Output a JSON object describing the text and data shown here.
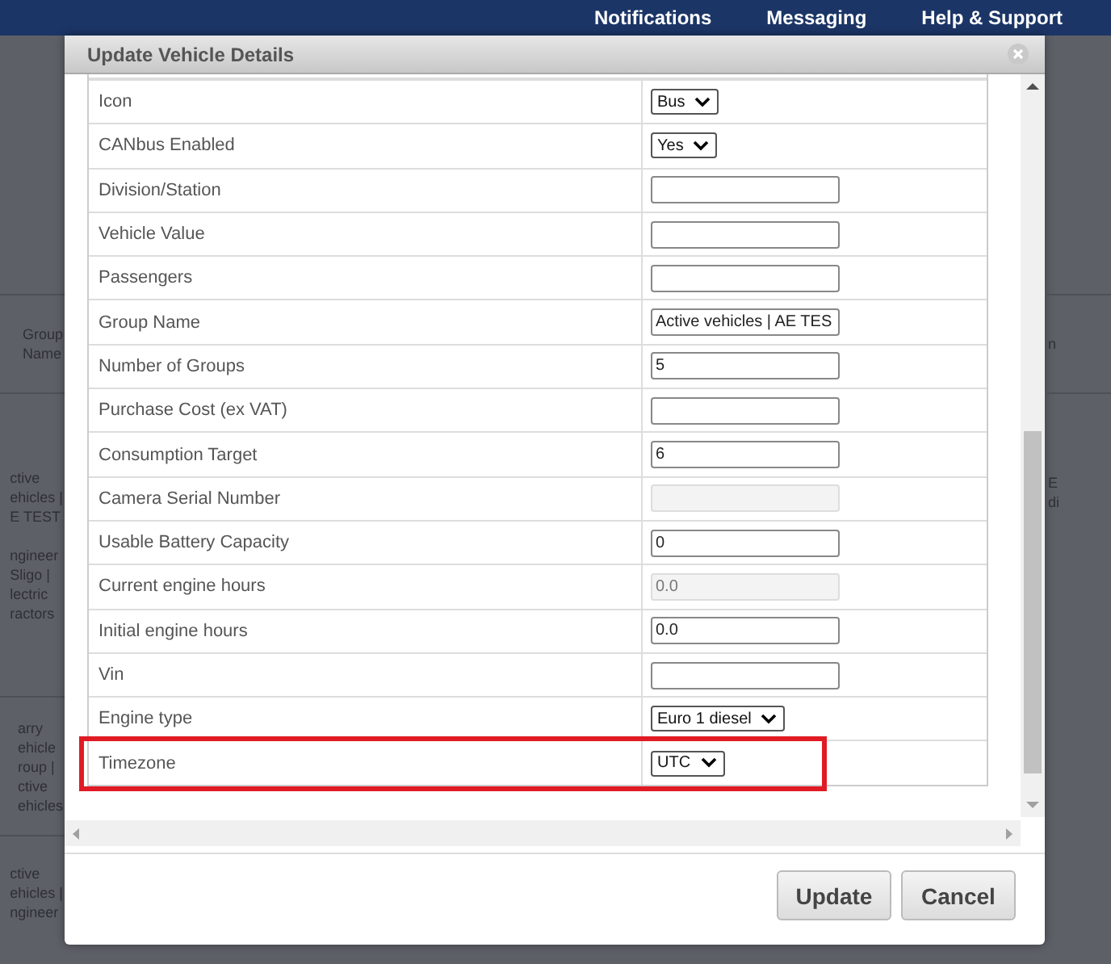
{
  "top_nav": [
    {
      "label": "Notifications"
    },
    {
      "label": "Messaging"
    },
    {
      "label": "Help & Support"
    }
  ],
  "background_table": {
    "left_column": [
      "Group\nName",
      "ctive\nehicles |\nE TEST\n\nngineer\nSligo |\nlectric\nractors",
      "arry\nehicle\nroup |\nctive\nehicles",
      "ctive\nehicles |\nngineer"
    ],
    "right_column": [
      "n",
      "E\ndi"
    ]
  },
  "dialog": {
    "title": "Update Vehicle Details",
    "rows": [
      {
        "label": "Icon",
        "kind": "select",
        "value": "Bus",
        "highlighted": false
      },
      {
        "label": "CANbus Enabled",
        "kind": "select",
        "value": "Yes",
        "highlighted": false
      },
      {
        "label": "Division/Station",
        "kind": "input",
        "highlighted": false
      },
      {
        "label": "Vehicle Value",
        "kind": "input",
        "highlighted": false
      },
      {
        "label": "Passengers",
        "kind": "input",
        "highlighted": false
      },
      {
        "label": "Group Name",
        "kind": "input",
        "value": "Active vehicles | AE TES",
        "highlighted": false
      },
      {
        "label": "Number of Groups",
        "kind": "input",
        "value": "5",
        "highlighted": false
      },
      {
        "label": "Purchase Cost (ex VAT)",
        "kind": "input",
        "highlighted": false
      },
      {
        "label": "Consumption Target",
        "kind": "input",
        "value": "6",
        "highlighted": false
      },
      {
        "label": "Camera Serial Number",
        "kind": "readonly",
        "highlighted": false
      },
      {
        "label": "Usable Battery Capacity",
        "kind": "input",
        "value": "0",
        "highlighted": false
      },
      {
        "label": "Current engine hours",
        "kind": "readonly",
        "value": "0.0",
        "highlighted": false
      },
      {
        "label": "Initial engine hours",
        "kind": "input",
        "value": "0.0",
        "highlighted": false
      },
      {
        "label": "Vin",
        "kind": "input",
        "highlighted": false
      },
      {
        "label": "Engine type",
        "kind": "select",
        "value": "Euro 1 diesel",
        "highlighted": false
      },
      {
        "label": "Timezone",
        "kind": "select",
        "value": "UTC",
        "highlighted": true
      }
    ],
    "buttons": [
      {
        "label": "Update"
      },
      {
        "label": "Cancel"
      }
    ]
  }
}
